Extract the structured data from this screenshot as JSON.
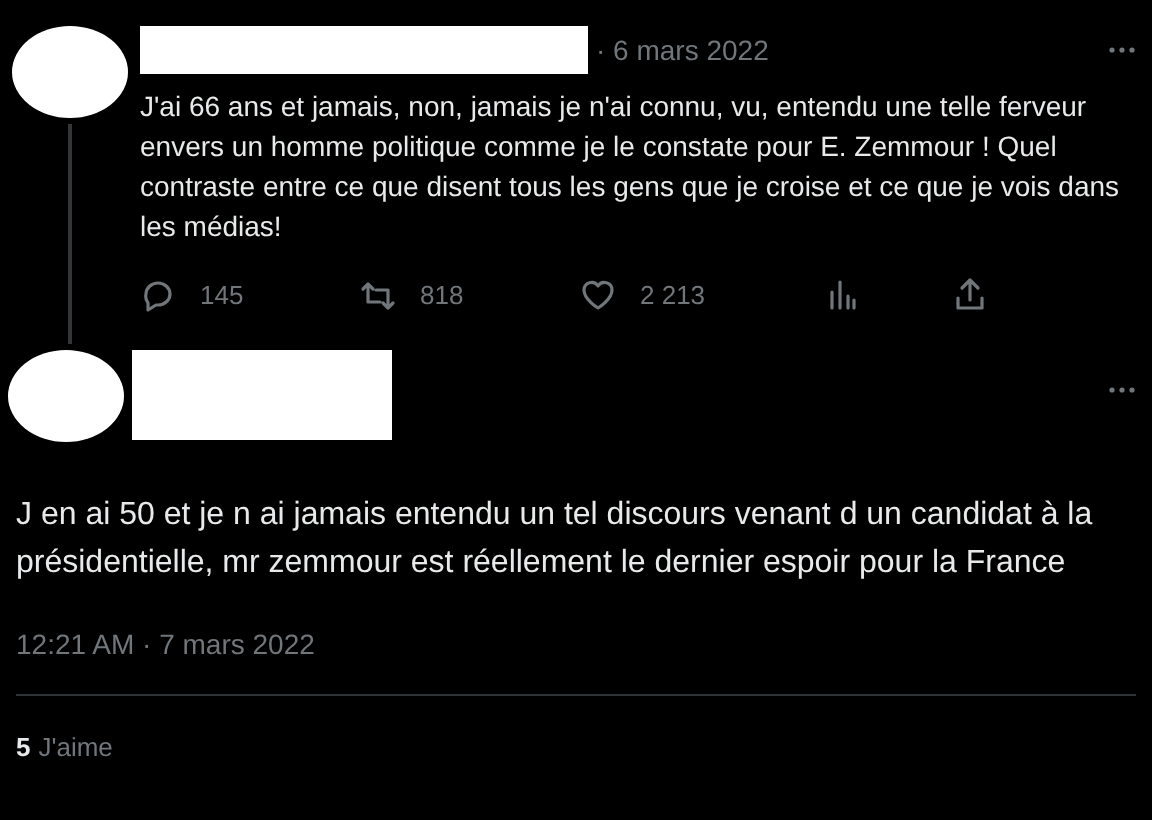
{
  "parent_tweet": {
    "date": "· 6 mars 2022",
    "text": "J'ai 66 ans et jamais, non, jamais je n'ai connu, vu, entendu une telle ferveur envers un homme politique comme je le constate pour E. Zemmour ! Quel contraste entre ce que disent tous les gens que je croise et ce que je vois dans les médias!",
    "actions": [
      {
        "kind": "reply",
        "count": "145"
      },
      {
        "kind": "retweet",
        "count": "818"
      },
      {
        "kind": "like",
        "count": "2 213"
      },
      {
        "kind": "analytics"
      },
      {
        "kind": "share"
      }
    ]
  },
  "main_tweet": {
    "text": "J en ai 50 et je n ai jamais entendu un tel discours venant d un candidat à la présidentielle, mr zemmour est réellement le dernier espoir pour la France",
    "timestamp": "12:21 AM · 7 mars 2022",
    "likes": {
      "count": "5",
      "label": "J'aime"
    }
  }
}
